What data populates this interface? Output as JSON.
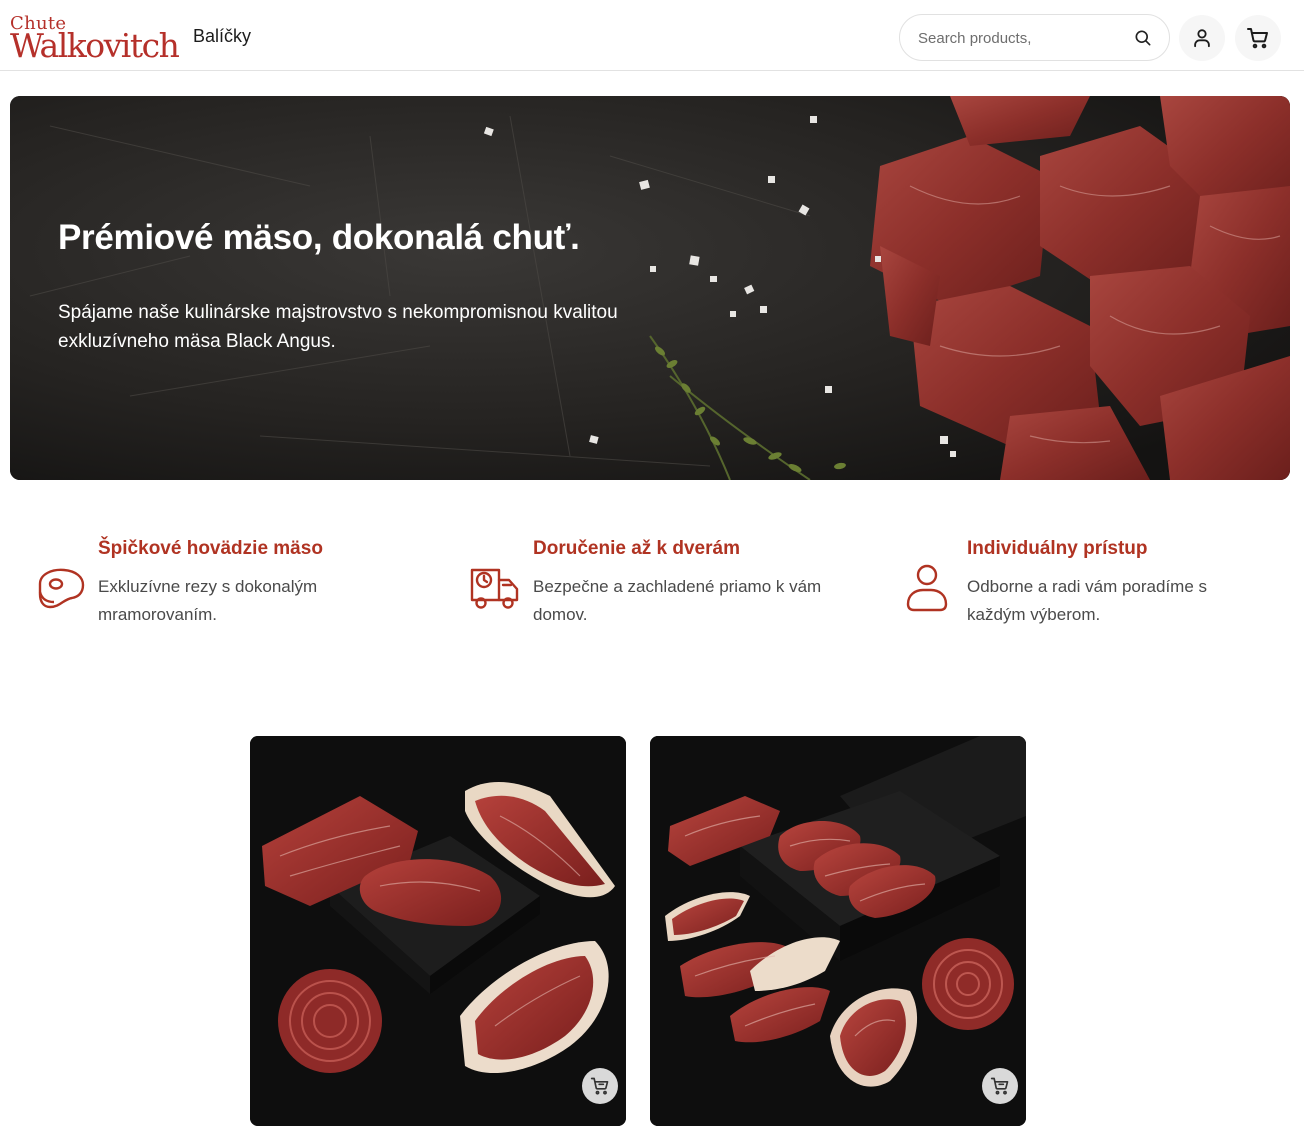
{
  "header": {
    "logo_small": "Chute",
    "logo_big": "Walkovitch",
    "nav_label": "Balíčky",
    "search_placeholder": "Search products,"
  },
  "hero": {
    "title": "Prémiové mäso, dokonalá chuť.",
    "text": "Spájame naše kulinárske majstrovstvo s nekompromisnou kvalitou exkluzívneho mäsa Black Angus."
  },
  "features": [
    {
      "icon": "steak-icon",
      "title": "Špičkové hovädzie mäso",
      "text": "Exkluzívne rezy s dokonalým mramorovaním."
    },
    {
      "icon": "delivery-truck-icon",
      "title": "Doručenie až k dverám",
      "text": "Bezpečne a zachladené priamo k vám domov."
    },
    {
      "icon": "person-icon",
      "title": "Individuálny prístup",
      "text": "Odborne a radi vám poradíme s každým výberom."
    }
  ],
  "products": [
    {
      "image": "meat-package-image",
      "cart_icon": "cart-icon"
    },
    {
      "image": "meat-package-image",
      "cart_icon": "cart-icon"
    }
  ],
  "colors": {
    "accent": "#b03322",
    "logo": "#b5302a",
    "hero_bg": "#1c1b1a",
    "product_bg": "#0d0d0d"
  }
}
